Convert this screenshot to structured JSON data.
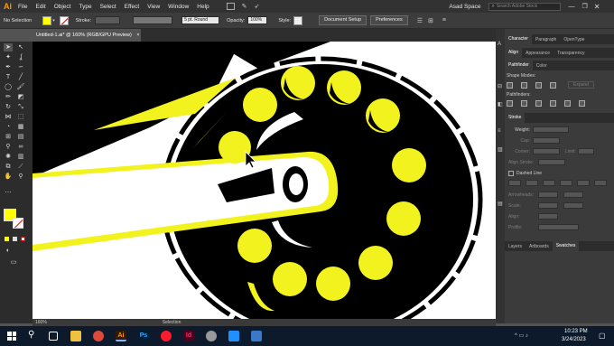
{
  "app": {
    "logo": "Ai",
    "workspace": "Asad Space",
    "search_placeholder": "Search Adobe Stock"
  },
  "menu": [
    "File",
    "Edit",
    "Object",
    "Type",
    "Select",
    "Effect",
    "View",
    "Window",
    "Help"
  ],
  "control_bar": {
    "selection_label": "No Selection",
    "fill_color": "#ffff00",
    "stroke_label": "Stroke:",
    "brush_label": "5 pt. Round",
    "opacity_label": "Opacity:",
    "opacity_value": "100%",
    "style_label": "Style:",
    "document_setup": "Document Setup",
    "preferences": "Preferences"
  },
  "document_tab": {
    "title": "Untitled-1.ai* @ 160% (RGB/GPU Preview)",
    "close": "×"
  },
  "status": {
    "zoom": "160%",
    "tool": "Selection"
  },
  "panel": {
    "tabs_top": [
      "Character",
      "Paragraph",
      "OpenType"
    ],
    "tabs_align": [
      "Align",
      "Appearance",
      "Transparency"
    ],
    "tabs_pathfinder": [
      "Pathfinder",
      "Color"
    ],
    "shape_modes": "Shape Modes:",
    "expand": "Expand",
    "pathfinders": "Pathfinders:",
    "stroke_title": "Stroke",
    "weight_label": "Weight:",
    "cap_label": "Cap:",
    "corner_label": "Corner:",
    "limit_label": "Limit:",
    "align_stroke_label": "Align Stroke:",
    "dashed_line": "Dashed Line",
    "arrowheads": "Arrowheads:",
    "scale_label": "Scale:",
    "align_label": "Align:",
    "profile_label": "Profile:",
    "tabs_bottom": [
      "Layers",
      "Artboards",
      "Swatches"
    ]
  },
  "colors": {
    "accent_yellow": "#f2f21e",
    "canvas": "#ffffff",
    "taskbar": "#0c1a2b"
  },
  "taskbar": {
    "time": "10:23 PM",
    "date": "3/24/2023"
  }
}
